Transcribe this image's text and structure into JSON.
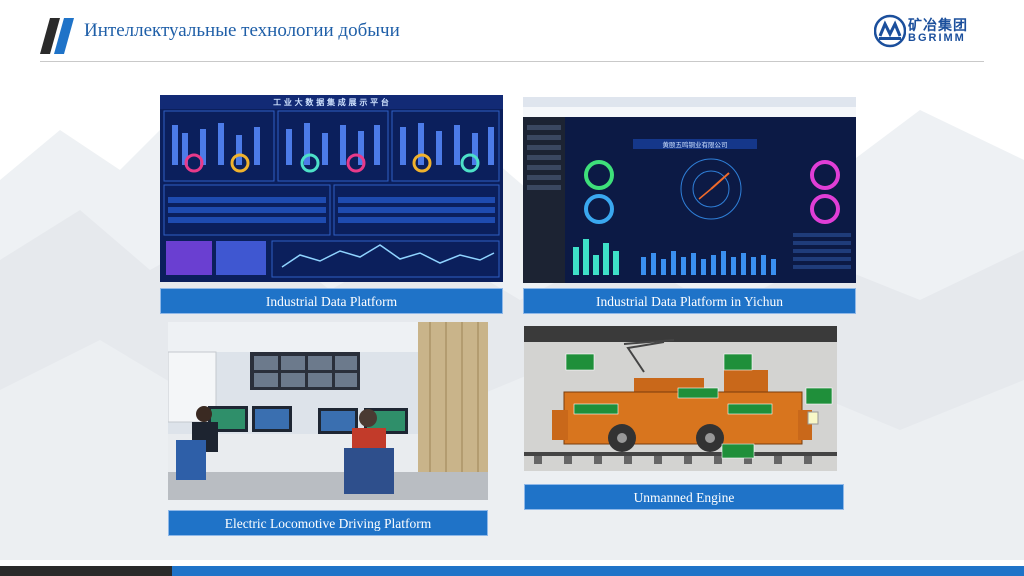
{
  "header": {
    "title": "Интеллектуальные технологии добычи",
    "logo_cn": "矿冶集团",
    "logo_en": "BGRIMM"
  },
  "panels": [
    {
      "caption": "Industrial Data Platform",
      "screen_title": "工 业 大 数 据 集 成 展 示 平 台"
    },
    {
      "caption": "Industrial Data Platform in Yichun",
      "screen_title": "黄颐五鸣铜业有限公司"
    },
    {
      "caption": "Electric Locomotive Driving Platform"
    },
    {
      "caption": "Unmanned Engine"
    }
  ],
  "colors": {
    "accent": "#1f73c8",
    "title": "#1f5fa8",
    "dashboard_bg": "#0b1f5c",
    "locomotive": "#d8751e"
  }
}
